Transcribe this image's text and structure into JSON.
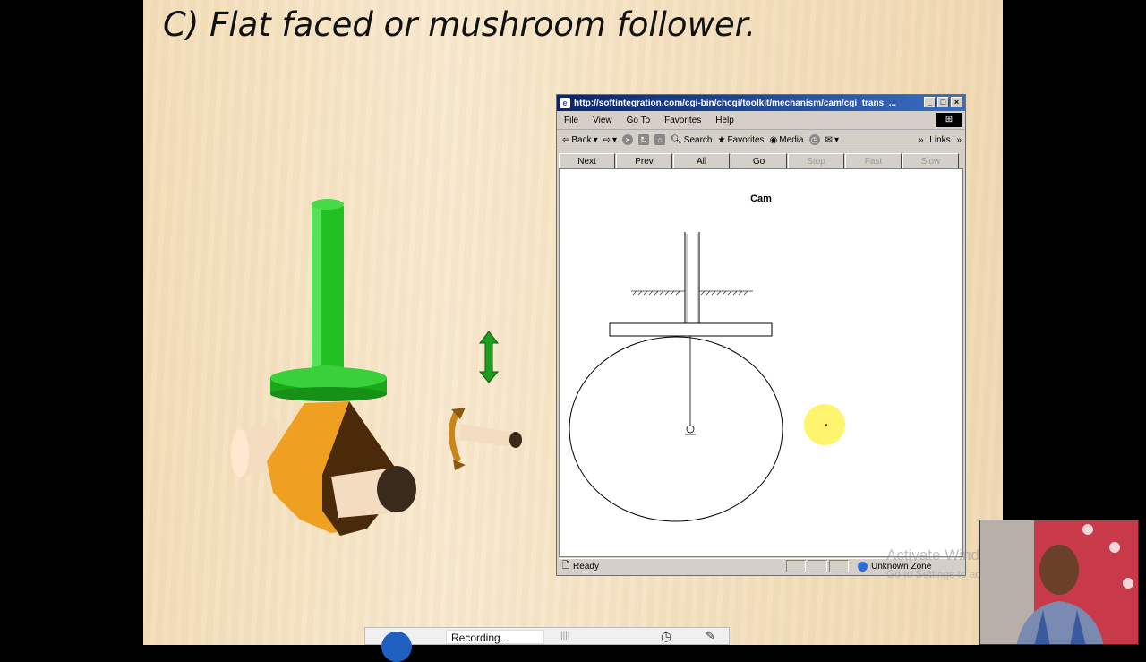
{
  "slide": {
    "title": "C) Flat faced or mushroom follower."
  },
  "browser": {
    "title": "http://softintegration.com/cgi-bin/chcgi/toolkit/mechanism/cam/cgi_trans_...",
    "menu": [
      "File",
      "View",
      "Go To",
      "Favorites",
      "Help"
    ],
    "toolbar": {
      "back": "Back",
      "search": "Search",
      "favorites": "Favorites",
      "media": "Media",
      "links": "Links"
    },
    "nav_buttons": [
      {
        "label": "Next",
        "enabled": true
      },
      {
        "label": "Prev",
        "enabled": true
      },
      {
        "label": "All",
        "enabled": true
      },
      {
        "label": "Go",
        "enabled": true
      },
      {
        "label": "Stop",
        "enabled": false
      },
      {
        "label": "Fast",
        "enabled": false
      },
      {
        "label": "Slow",
        "enabled": false
      }
    ],
    "content_title": "Cam",
    "status": {
      "left": "Ready",
      "zone": "Unknown Zone"
    }
  },
  "watermark": {
    "line1": "Activate Windows",
    "line2": "Go to Settings to activate Windows."
  },
  "recorder": {
    "status": "Recording..."
  },
  "colors": {
    "follower_green": "#22c022",
    "cam_orange": "#f0a020",
    "cam_brown": "#4a2a08",
    "title_bar": "#0a246a"
  }
}
